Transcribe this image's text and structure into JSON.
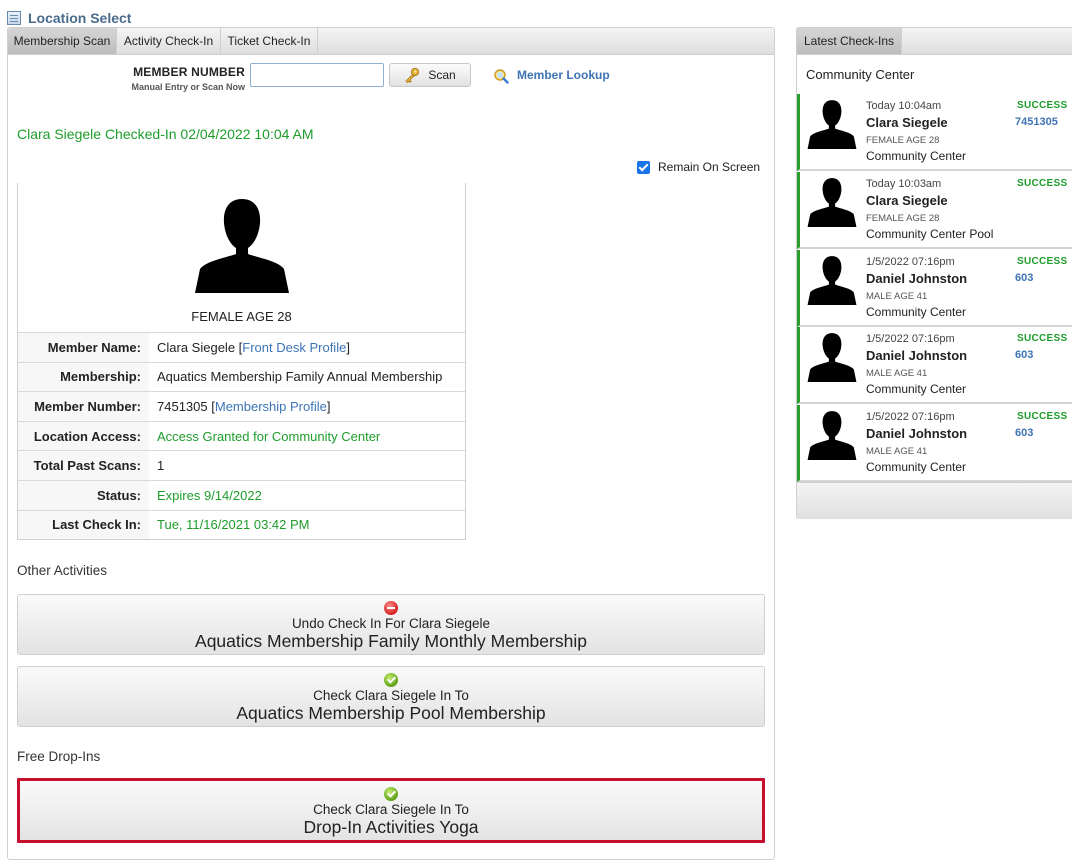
{
  "header": {
    "title": "Location Select"
  },
  "tabs": [
    {
      "label": "Membership Scan",
      "active": true
    },
    {
      "label": "Activity Check-In",
      "active": false
    },
    {
      "label": "Ticket Check-In",
      "active": false
    }
  ],
  "scan": {
    "label": "MEMBER NUMBER",
    "sublabel": "Manual Entry or Scan Now",
    "input_value": "",
    "button_label": "Scan",
    "lookup_label": "Member Lookup"
  },
  "checked_in_message": "Clara Siegele Checked-In 02/04/2022 10:04 AM",
  "remain_on_screen": {
    "label": "Remain On Screen",
    "checked": true
  },
  "member": {
    "age_label": "FEMALE AGE 28",
    "rows": [
      {
        "key": "Member Name:",
        "value": "Clara Siegele",
        "link": "Front Desk Profile"
      },
      {
        "key": "Membership:",
        "value": "Aquatics Membership Family Annual Membership"
      },
      {
        "key": "Member Number:",
        "value": "7451305",
        "link": "Membership Profile"
      },
      {
        "key": "Location Access:",
        "value": "Access Granted for Community Center"
      },
      {
        "key": "Total Past Scans:",
        "value": "1"
      },
      {
        "key": "Status:",
        "value": "Expires 9/14/2022"
      },
      {
        "key": "Last Check In:",
        "value": "Tue, 11/16/2021 03:42 PM"
      }
    ]
  },
  "other_activities": {
    "label": "Other Activities",
    "buttons": [
      {
        "line1": "Undo Check In For Clara Siegele",
        "line2": "Aquatics Membership Family Monthly Membership",
        "icon": "remove-icon"
      },
      {
        "line1": "Check Clara Siegele In To",
        "line2": "Aquatics Membership Pool Membership",
        "icon": "check-icon"
      }
    ]
  },
  "free_dropins": {
    "label": "Free Drop-Ins",
    "buttons": [
      {
        "line1": "Check Clara Siegele In To",
        "line2": "Drop-In Activities Yoga",
        "icon": "check-icon"
      }
    ]
  },
  "latest": {
    "tab_label": "Latest Check-Ins",
    "location": "Community Center",
    "entries": [
      {
        "time": "Today 10:04am",
        "name": "Clara Siegele",
        "age": "FEMALE AGE 28",
        "location": "Community Center",
        "status": "SUCCESS",
        "number": "7451305"
      },
      {
        "time": "Today 10:03am",
        "name": "Clara Siegele",
        "age": "FEMALE AGE 28",
        "location": "Community Center Pool",
        "status": "SUCCESS",
        "number": ""
      },
      {
        "time": "1/5/2022 07:16pm",
        "name": "Daniel Johnston",
        "age": "MALE AGE 41",
        "location": "Community Center",
        "status": "SUCCESS",
        "number": "603"
      },
      {
        "time": "1/5/2022 07:16pm",
        "name": "Daniel Johnston",
        "age": "MALE AGE 41",
        "location": "Community Center",
        "status": "SUCCESS",
        "number": "603"
      },
      {
        "time": "1/5/2022 07:16pm",
        "name": "Daniel Johnston",
        "age": "MALE AGE 41",
        "location": "Community Center",
        "status": "SUCCESS",
        "number": "603"
      }
    ]
  },
  "colors": {
    "success_green": "#1e9d2b",
    "link_blue": "#3d74b5",
    "highlight_red": "#c8102e",
    "accent_bar": "#2a9d2a"
  }
}
